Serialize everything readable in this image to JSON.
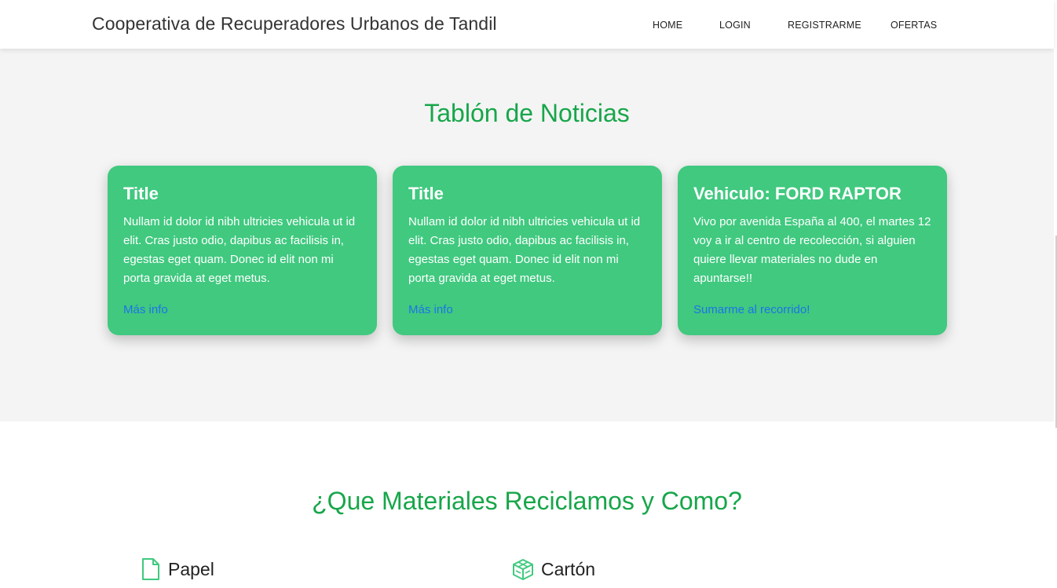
{
  "navbar": {
    "brand": "Cooperativa de Recuperadores Urbanos de Tandil",
    "links": [
      {
        "label": "HOME"
      },
      {
        "label": "LOGIN"
      },
      {
        "label": "REGISTRARME"
      },
      {
        "label": "OFERTAS"
      }
    ]
  },
  "news": {
    "title": "Tablón de Noticias",
    "cards": [
      {
        "title": "Title",
        "text": "Nullam id dolor id nibh ultricies vehicula ut id elit. Cras justo odio, dapibus ac facilisis in, egestas eget quam. Donec id elit non mi porta gravida at eget metus.",
        "link": "Más info"
      },
      {
        "title": "Title",
        "text": "Nullam id dolor id nibh ultricies vehicula ut id elit. Cras justo odio, dapibus ac facilisis in, egestas eget quam. Donec id elit non mi porta gravida at eget metus.",
        "link": "Más info"
      },
      {
        "title": "Vehiculo: FORD RAPTOR",
        "text": "Vivo por avenida España al 400, el martes 12 voy a ir al centro de recolección, si alguien quiere llevar materiales no dude en apuntarse!!",
        "link": "Sumarme al recorrido!"
      }
    ]
  },
  "materials": {
    "title": "¿Que Materiales Reciclamos y Como?",
    "items": [
      {
        "label": "Papel",
        "icon": "file-icon"
      },
      {
        "label": "Cartón",
        "icon": "boxes-icon"
      }
    ]
  },
  "colors": {
    "accent": "#17a64a",
    "card": "#40c97f",
    "link": "#1e72e8",
    "section_bg": "#f4f4f4"
  }
}
